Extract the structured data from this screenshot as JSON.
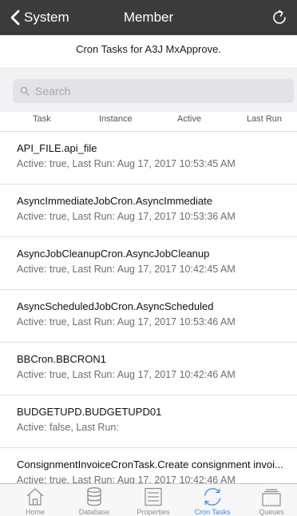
{
  "navbar": {
    "back_label": "System",
    "title": "Member",
    "background": "#3b3b3b"
  },
  "subtitle": "Cron Tasks for A3J MxApprove.",
  "search": {
    "placeholder": "Search",
    "value": ""
  },
  "columns": [
    "Task",
    "Instance",
    "Active",
    "Last Run"
  ],
  "tasks": [
    {
      "name": "API_FILE.api_file",
      "detail": "Active: true, Last Run: Aug 17, 2017 10:53:45 AM"
    },
    {
      "name": "AsyncImmediateJobCron.AsyncImmediate",
      "detail": "Active: true, Last Run: Aug 17, 2017 10:53:36 AM"
    },
    {
      "name": "AsyncJobCleanupCron.AsyncJobCleanup",
      "detail": "Active: true, Last Run: Aug 17, 2017 10:42:45 AM"
    },
    {
      "name": "AsyncScheduledJobCron.AsyncScheduled",
      "detail": "Active: true, Last Run: Aug 17, 2017 10:53:46 AM"
    },
    {
      "name": "BBCron.BBCRON1",
      "detail": "Active: true, Last Run: Aug 17, 2017 10:42:46 AM"
    },
    {
      "name": "BUDGETUPD.BUDGETUPD01",
      "detail": "Active: false, Last Run:"
    },
    {
      "name": "ConsignmentInvoiceCronTask.Create consignment invoi...",
      "detail": "Active: true, Last Run: Aug 17, 2017 10:42:46 AM"
    }
  ],
  "tabs": [
    {
      "label": "Home",
      "icon": "home-icon",
      "active": false
    },
    {
      "label": "Database",
      "icon": "database-icon",
      "active": false
    },
    {
      "label": "Properties",
      "icon": "properties-icon",
      "active": false
    },
    {
      "label": "Cron Tasks",
      "icon": "cron-tasks-icon",
      "active": true
    },
    {
      "label": "Queues",
      "icon": "queues-icon",
      "active": false
    }
  ],
  "colors": {
    "accent": "#2f8af0",
    "inactive": "#8e8e93"
  }
}
